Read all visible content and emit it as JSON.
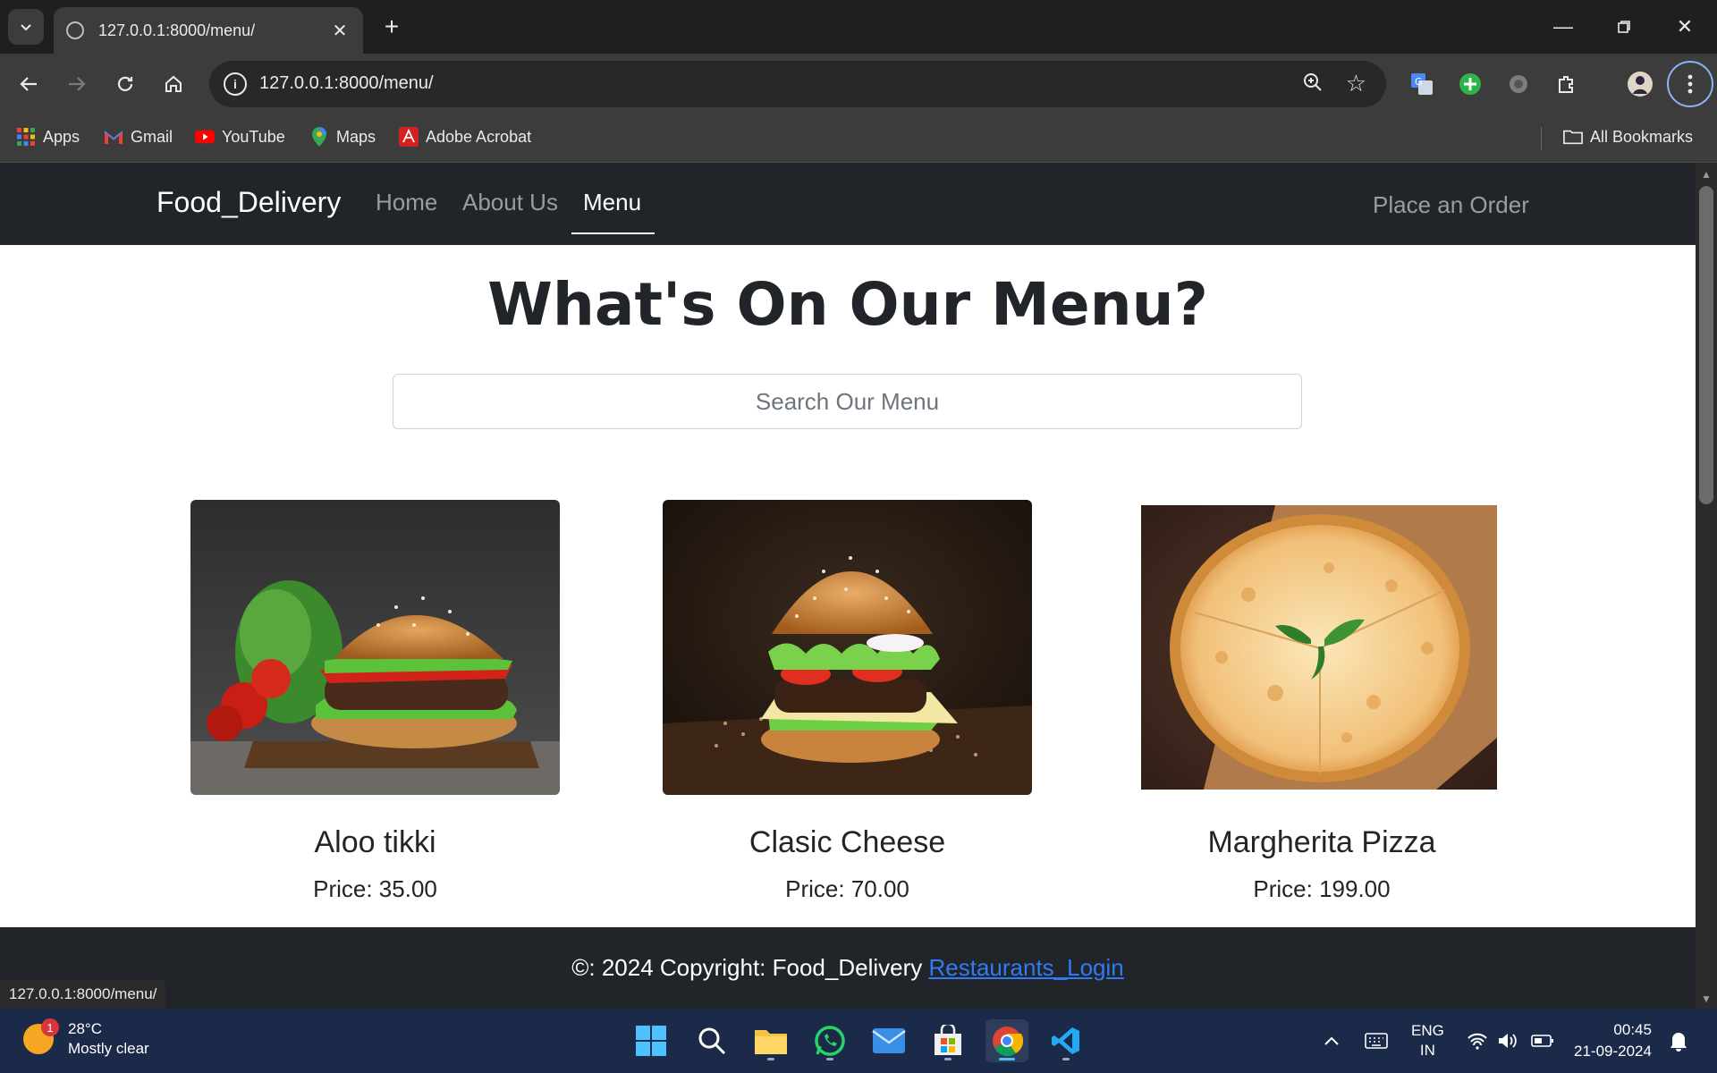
{
  "browser": {
    "tab_title": "127.0.0.1:8000/menu/",
    "url": "127.0.0.1:8000/menu/",
    "bookmarks": [
      {
        "label": "Apps",
        "icon": "apps-grid-icon"
      },
      {
        "label": "Gmail",
        "icon": "gmail-icon"
      },
      {
        "label": "YouTube",
        "icon": "youtube-icon"
      },
      {
        "label": "Maps",
        "icon": "maps-icon"
      },
      {
        "label": "Adobe Acrobat",
        "icon": "acrobat-icon"
      }
    ],
    "all_bookmarks": "All Bookmarks",
    "status_url": "127.0.0.1:8000/menu/"
  },
  "site": {
    "brand": "Food_Delivery",
    "nav": [
      "Home",
      "About Us",
      "Menu"
    ],
    "active_nav": "Menu",
    "order_link": "Place an Order",
    "heading": "What's On Our Menu?",
    "search_placeholder": "Search Our Menu",
    "items": [
      {
        "name": "Aloo tikki",
        "price": "Price: 35.00"
      },
      {
        "name": "Clasic Cheese",
        "price": "Price: 70.00"
      },
      {
        "name": "Margherita Pizza",
        "price": "Price: 199.00"
      }
    ],
    "footer_text": "©: 2024 Copyright: Food_Delivery",
    "footer_link": "Restaurants_Login"
  },
  "taskbar": {
    "weather_temp": "28°C",
    "weather_desc": "Mostly clear",
    "weather_badge": "1",
    "lang_top": "ENG",
    "lang_bottom": "IN",
    "time": "00:45",
    "date": "21-09-2024"
  },
  "colors": {
    "navbar": "#212529",
    "link": "#2f7bf5",
    "taskbar": "#1c2a4a"
  }
}
